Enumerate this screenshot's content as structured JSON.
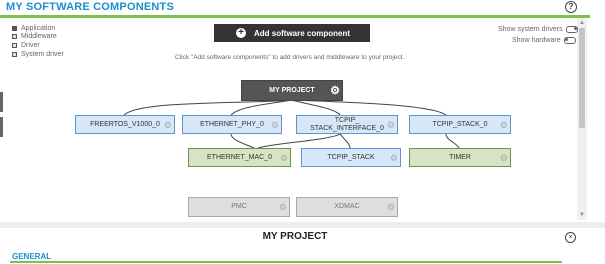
{
  "header": {
    "title": "MY SOFTWARE COMPONENTS",
    "help_icon": "?"
  },
  "legend": {
    "items": [
      {
        "label": "Application",
        "color": "#555555"
      },
      {
        "label": "Middleware",
        "color": "#d6e4c4"
      },
      {
        "label": "Driver",
        "color": "#d6e7f7"
      },
      {
        "label": "System driver",
        "color": "#dedede"
      }
    ]
  },
  "toolbar": {
    "add_button_label": "Add software component",
    "add_icon": "+",
    "hint": "Click \"Add software components\" to add drivers and middleware to your project."
  },
  "toggles": {
    "system_drivers_label": "Show system drivers",
    "system_drivers_on": true,
    "hardware_label": "Show hardware",
    "hardware_on": false
  },
  "graph": {
    "root": {
      "label": "MY PROJECT"
    },
    "level1": [
      {
        "label": "FREERTOS_V1000_0"
      },
      {
        "label": "ETHERNET_PHY_0"
      },
      {
        "label": "TCPIP_\nSTACK_INTERFACE_0"
      },
      {
        "label": "TCPIP_STACK_0"
      }
    ],
    "level2": [
      {
        "label": "ETHERNET_MAC_0"
      },
      {
        "label": "TCPIP_STACK"
      },
      {
        "label": "TIMER"
      }
    ],
    "system": [
      {
        "label": "PMC"
      },
      {
        "label": "XDMAC"
      }
    ]
  },
  "details": {
    "title": "MY PROJECT",
    "close_icon": "×",
    "section": "GENERAL"
  }
}
